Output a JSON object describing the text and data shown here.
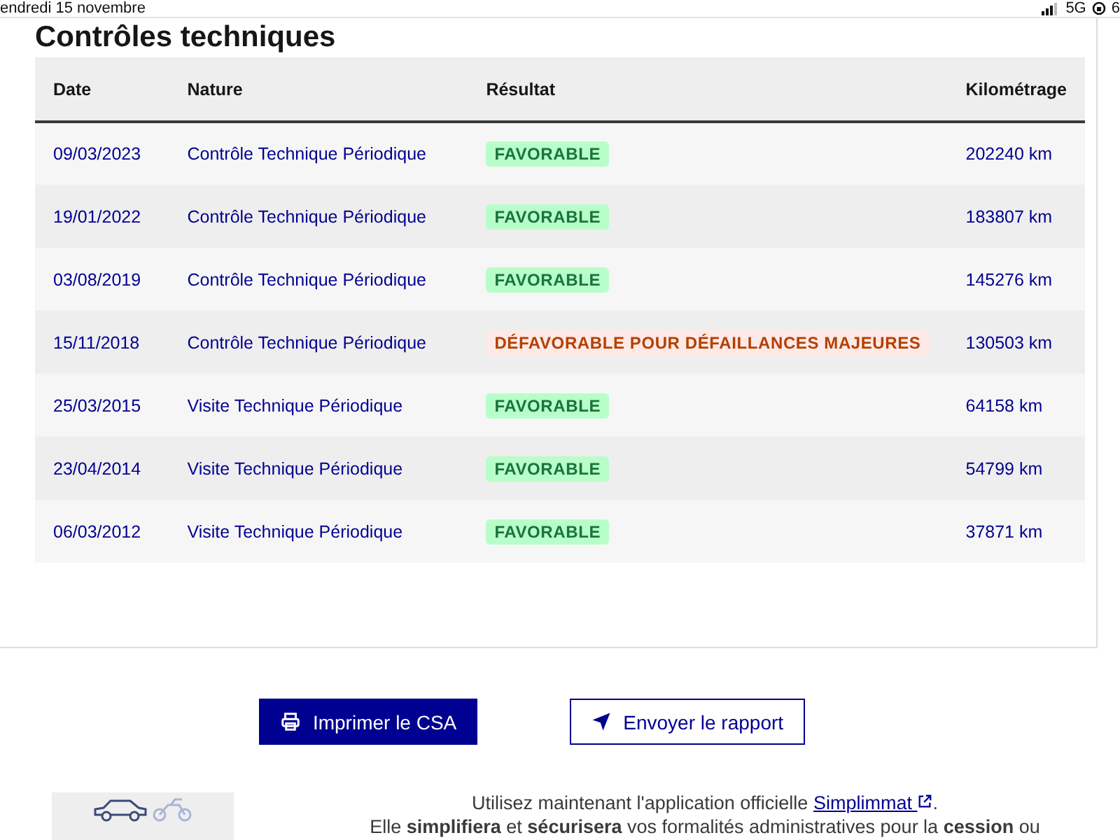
{
  "status_bar": {
    "date": "endredi 15 novembre",
    "network": "5G",
    "battery": "6"
  },
  "section": {
    "title": "Contrôles techniques",
    "table": {
      "columns": [
        "Date",
        "Nature",
        "Résultat",
        "Kilométrage"
      ],
      "rows": [
        {
          "date": "09/03/2023",
          "nature": "Contrôle Technique Périodique",
          "result": {
            "label": "FAVORABLE",
            "kind": "success"
          },
          "mileage": "202240 km"
        },
        {
          "date": "19/01/2022",
          "nature": "Contrôle Technique Périodique",
          "result": {
            "label": "FAVORABLE",
            "kind": "success"
          },
          "mileage": "183807 km"
        },
        {
          "date": "03/08/2019",
          "nature": "Contrôle Technique Périodique",
          "result": {
            "label": "FAVORABLE",
            "kind": "success"
          },
          "mileage": "145276 km"
        },
        {
          "date": "15/11/2018",
          "nature": "Contrôle Technique Périodique",
          "result": {
            "label": "DÉFAVORABLE POUR DÉFAILLANCES MAJEURES",
            "kind": "error"
          },
          "mileage": "130503 km"
        },
        {
          "date": "25/03/2015",
          "nature": "Visite Technique Périodique",
          "result": {
            "label": "FAVORABLE",
            "kind": "success"
          },
          "mileage": "64158 km"
        },
        {
          "date": "23/04/2014",
          "nature": "Visite Technique Périodique",
          "result": {
            "label": "FAVORABLE",
            "kind": "success"
          },
          "mileage": "54799 km"
        },
        {
          "date": "06/03/2012",
          "nature": "Visite Technique Périodique",
          "result": {
            "label": "FAVORABLE",
            "kind": "success"
          },
          "mileage": "37871 km"
        }
      ]
    }
  },
  "actions": [
    {
      "label": "Imprimer le CSA",
      "kind": "primary"
    },
    {
      "label": "Envoyer le rapport",
      "kind": "secondary"
    }
  ],
  "promo": {
    "intro": "Utilisez maintenant l'application officielle",
    "link": "Simplimmat",
    "end": ".",
    "text": "Elle **simplifiera** et **sécurisera** vos formalités administratives pour la **cession** ou"
  }
}
